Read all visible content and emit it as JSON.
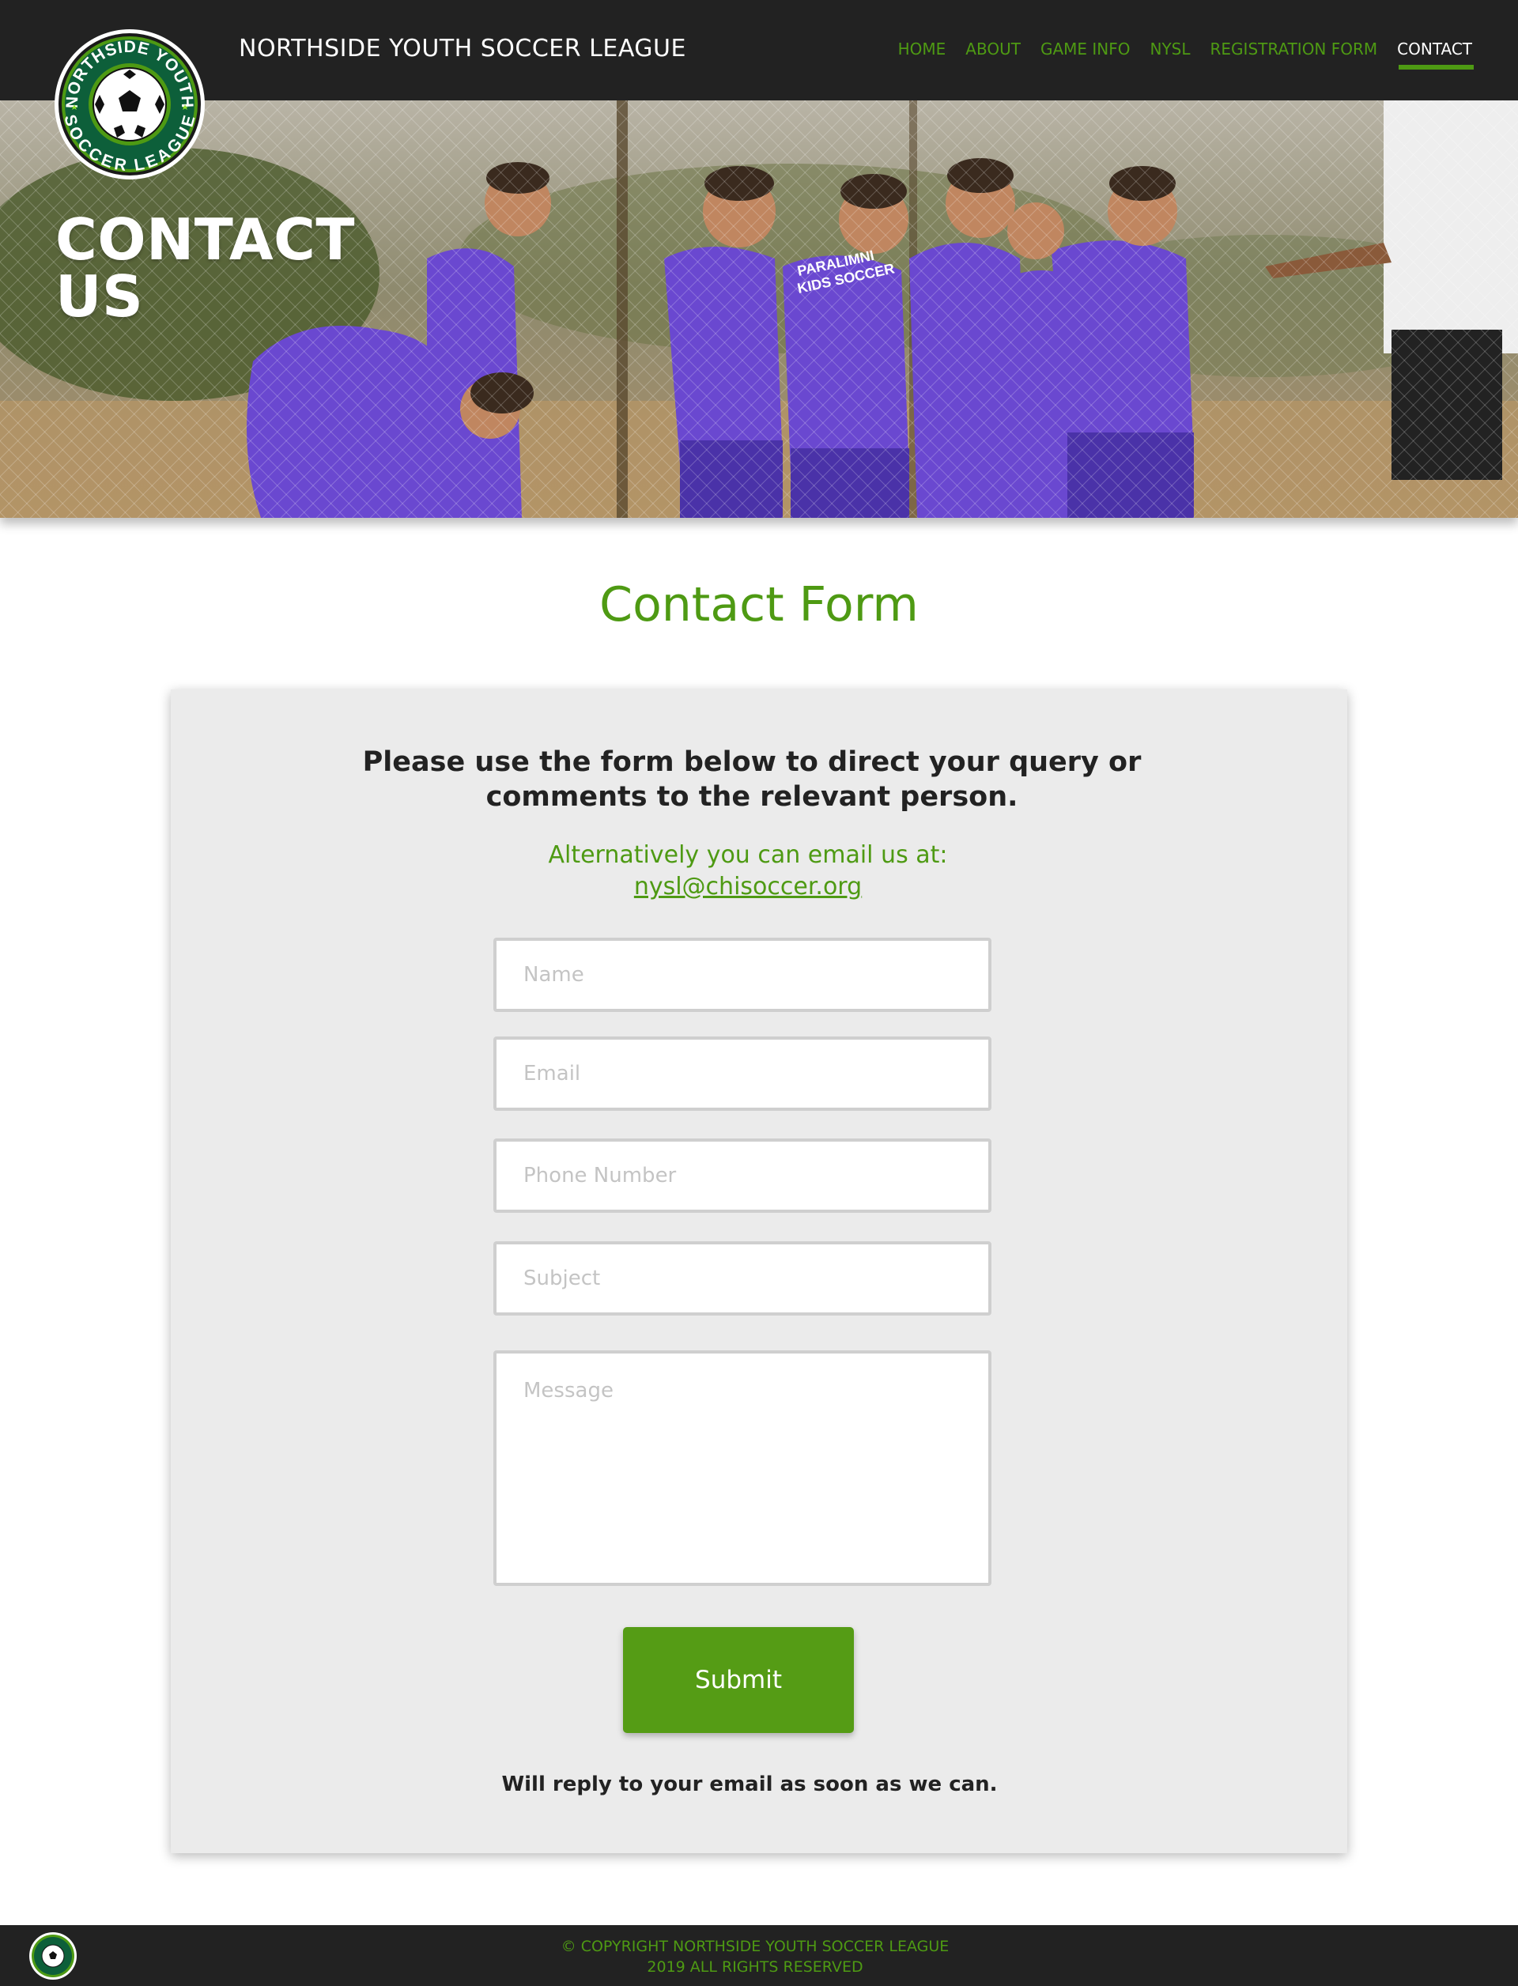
{
  "brand": {
    "logo_text_top": "NORTHSIDE YOUTH",
    "logo_text_bottom": "SOCCER LEAGUE",
    "site_title": "NORTHSIDE YOUTH SOCCER LEAGUE"
  },
  "nav": {
    "items": [
      {
        "label": "HOME"
      },
      {
        "label": "ABOUT"
      },
      {
        "label": "GAME INFO"
      },
      {
        "label": "NYSL"
      },
      {
        "label": "REGISTRATION FORM"
      },
      {
        "label": "CONTACT",
        "active": true
      }
    ]
  },
  "hero": {
    "title_line1": "CONTACT",
    "title_line2": "US",
    "jersey_text_1": "PARALIMNI",
    "jersey_text_2": "KIDS SOCCER"
  },
  "main": {
    "page_title": "Contact Form",
    "intro_line1": "Please use the form below to direct your query or",
    "intro_line2": "comments to the relevant person.",
    "alt_text": "Alternatively you can email us at:",
    "alt_email": "nysl@chisoccer.org",
    "form": {
      "name_placeholder": "Name",
      "email_placeholder": "Email",
      "phone_placeholder": "Phone Number",
      "subject_placeholder": "Subject",
      "message_placeholder": "Message",
      "submit_label": "Submit"
    },
    "reply_note": "Will reply to your email as soon as we can."
  },
  "footer": {
    "copyright_line1": "© COPYRIGHT NORTHSIDE YOUTH SOCCER LEAGUE",
    "copyright_line2": "2019 ALL RIGHTS RESERVED"
  },
  "colors": {
    "accent_green": "#4e9a13",
    "button_green": "#559c15",
    "header_bg": "#222222",
    "card_bg": "#ebebeb",
    "jersey_purple": "#6a48d0"
  }
}
